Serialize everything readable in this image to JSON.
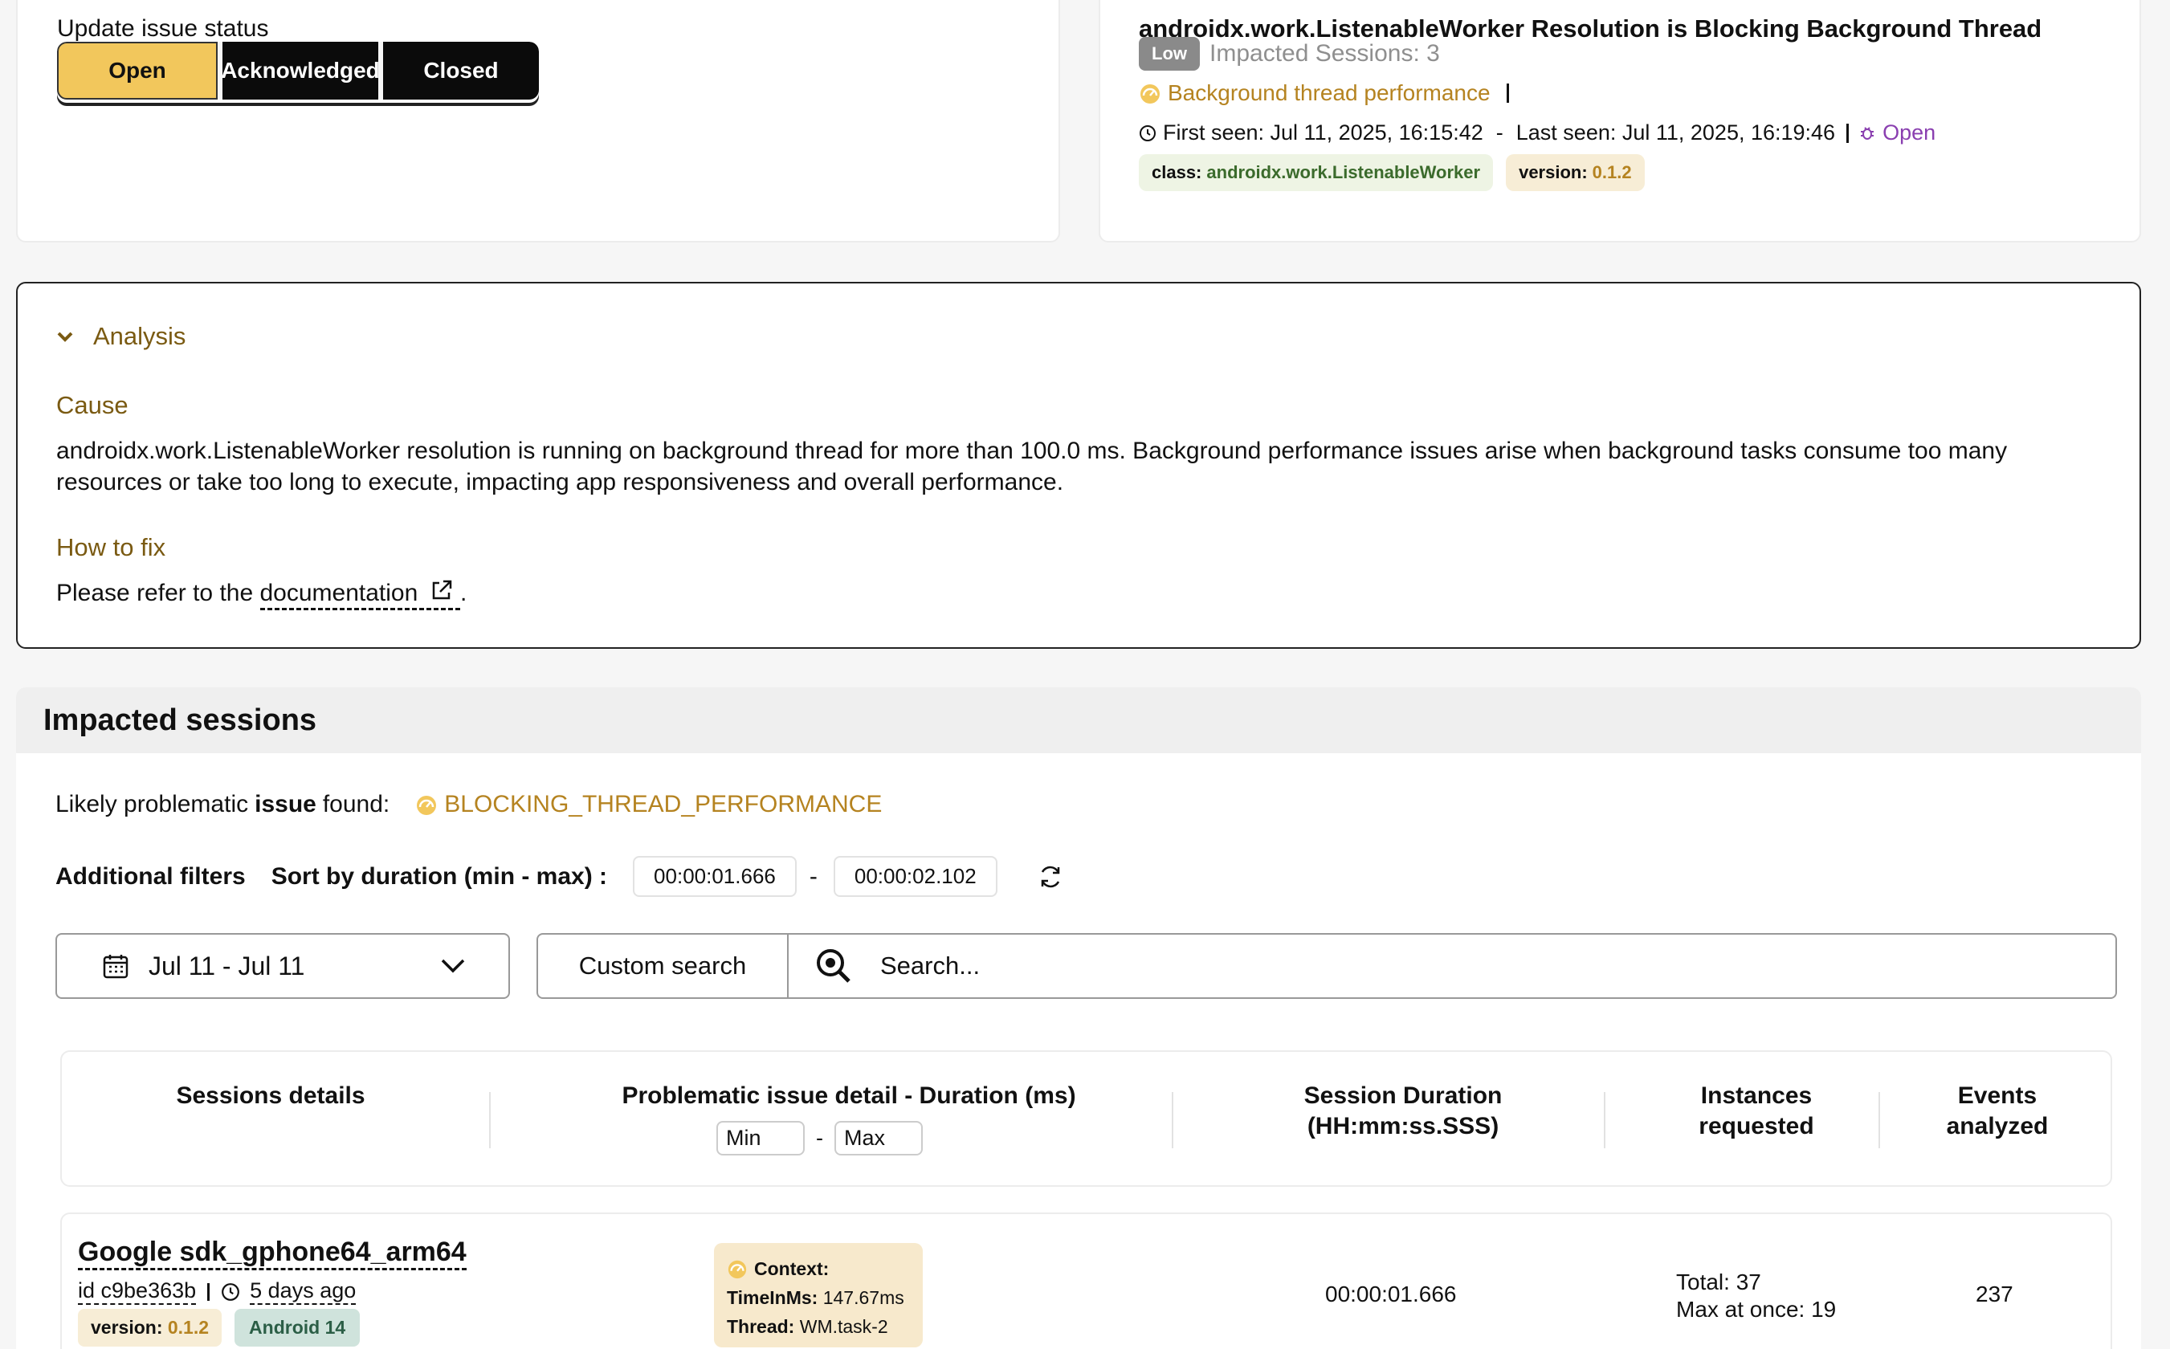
{
  "status": {
    "title": "Update issue status",
    "buttons": {
      "open": "Open",
      "acknowledged": "Acknowledged",
      "closed": "Closed"
    }
  },
  "issue": {
    "title": "androidx.work.ListenableWorker Resolution is Blocking Background Thread",
    "severity": "Low",
    "impacted_sessions": "Impacted Sessions: 3",
    "category": "Background thread performance",
    "first_seen": "First seen: Jul 11, 2025, 16:15:42",
    "last_seen": "Last seen: Jul 11, 2025, 16:19:46",
    "seen_separator": "-",
    "state": "Open",
    "tags": {
      "class_key": "class:",
      "class_value": "androidx.work.ListenableWorker",
      "version_key": "version:",
      "version_value": "0.1.2"
    }
  },
  "analysis": {
    "heading": "Analysis",
    "cause_label": "Cause",
    "cause_text": "androidx.work.ListenableWorker resolution is running on background thread for more than 100.0 ms. Background performance issues arise when background tasks consume too many resources or take too long to execute, impacting app responsiveness and overall performance.",
    "fix_label": "How to fix",
    "fix_prefix": "Please refer to the",
    "fix_link": "documentation",
    "fix_suffix": "."
  },
  "sessions": {
    "title": "Impacted sessions",
    "likely_prefix": "Likely problematic",
    "likely_bold": "issue",
    "likely_suffix": "found:",
    "issue_code": "BLOCKING_THREAD_PERFORMANCE",
    "filters_label": "Additional filters",
    "sort_label": "Sort by duration (min - max) :",
    "min_duration": "00:00:01.666",
    "max_duration": "00:00:02.102",
    "range_separator": "-",
    "date_range": "Jul 11 - Jul 11",
    "custom_search": "Custom search",
    "search_placeholder": "Search...",
    "columns": {
      "details": "Sessions details",
      "problem": "Problematic issue detail - Duration (ms)",
      "min": "Min",
      "max": "Max",
      "minmax_sep": "-",
      "session_duration_1": "Session Duration",
      "session_duration_2": "(HH:mm:ss.SSS)",
      "instances_1": "Instances",
      "instances_2": "requested",
      "events_1": "Events",
      "events_2": "analyzed"
    },
    "rows": [
      {
        "device": "Google sdk_gphone64_arm64",
        "id": "id c9be363b",
        "ago": "5 days ago",
        "version_key": "version:",
        "version_value": "0.1.2",
        "os": "Android 14",
        "context_label": "Context:",
        "time_key": "TimeInMs:",
        "time_value": "147.67ms",
        "thread_key": "Thread:",
        "thread_value": "WM.task-2",
        "duration": "00:00:01.666",
        "instances_total": "Total: 37",
        "instances_max": "Max at once: 19",
        "events": "237"
      }
    ]
  },
  "colors": {
    "accent": "#f2c75c",
    "brown": "#7a5a12",
    "gold": "#b58320",
    "purple": "#8a3fb0"
  }
}
